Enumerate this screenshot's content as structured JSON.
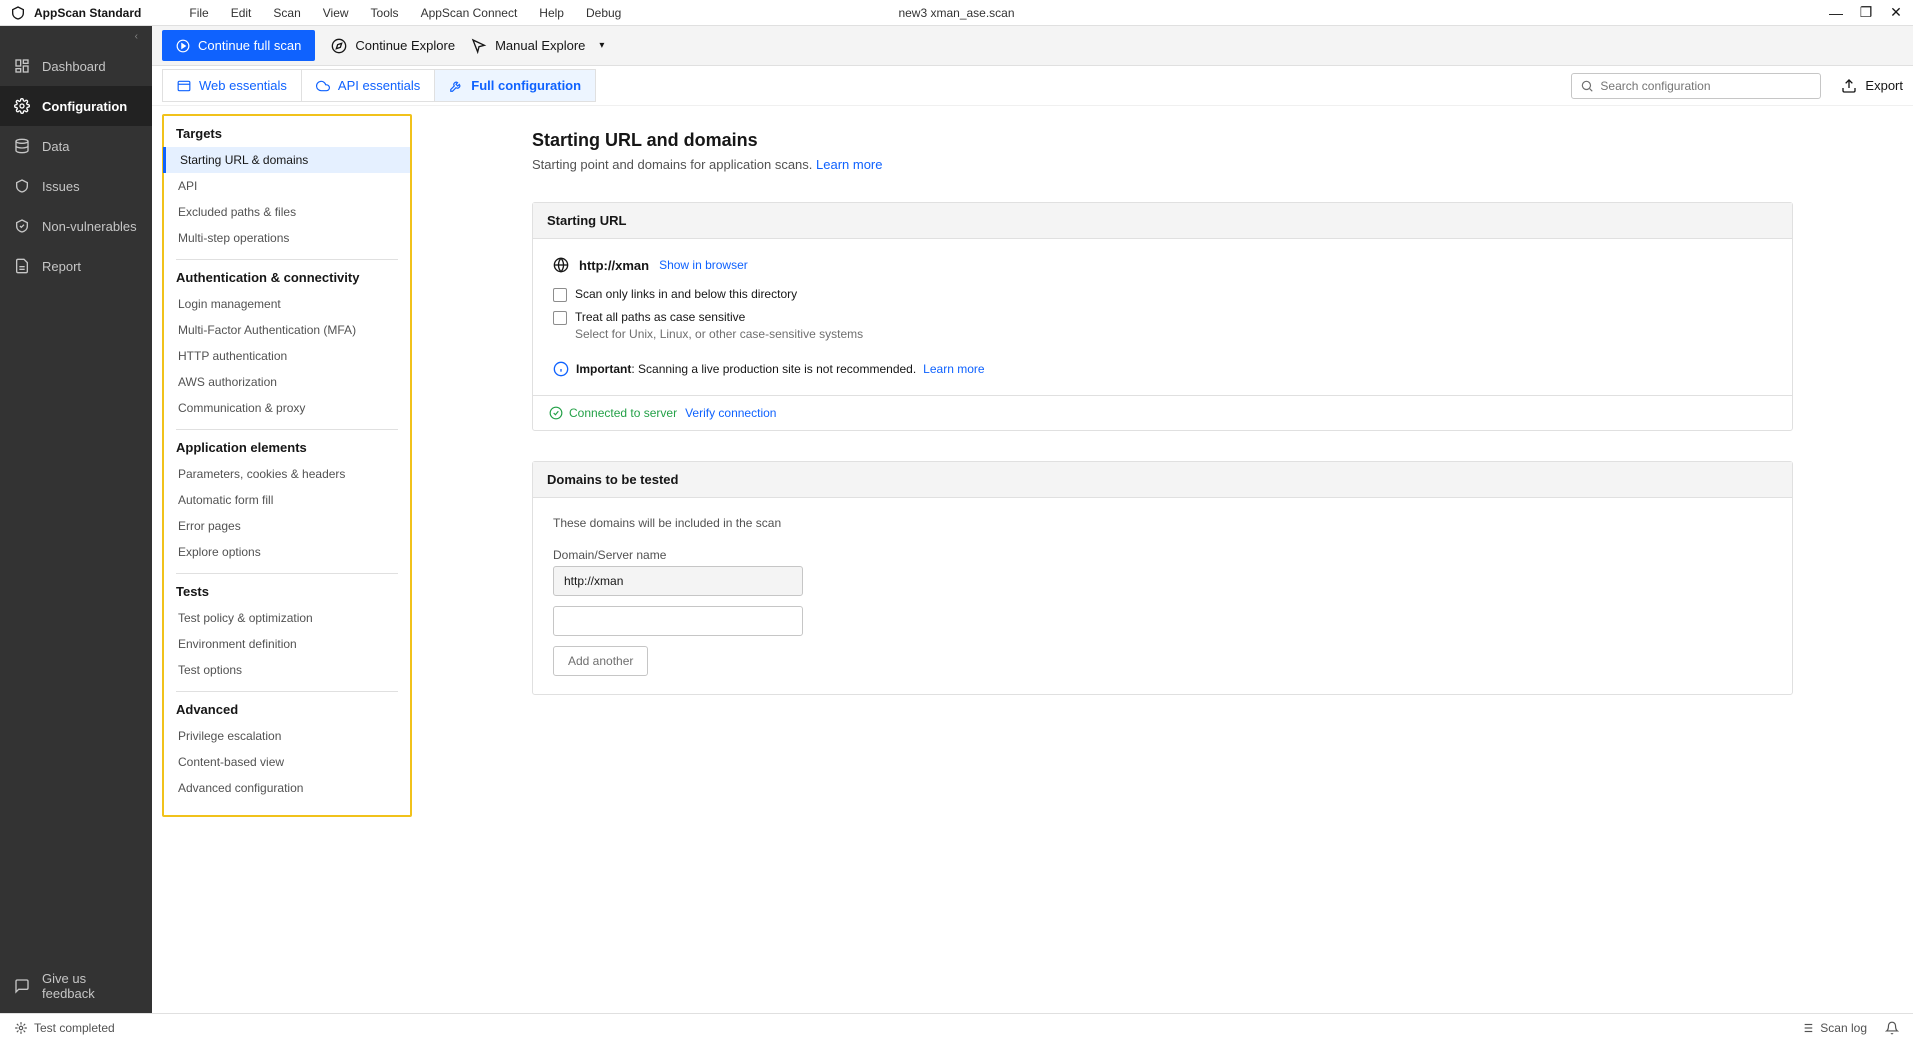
{
  "app": {
    "name": "AppScan Standard",
    "document": "new3 xman_ase.scan"
  },
  "menubar": [
    "File",
    "Edit",
    "Scan",
    "View",
    "Tools",
    "AppScan Connect",
    "Help",
    "Debug"
  ],
  "toolbar": {
    "continue_full": "Continue full scan",
    "continue_explore": "Continue Explore",
    "manual_explore": "Manual Explore"
  },
  "sidebar": {
    "items": [
      {
        "label": "Dashboard"
      },
      {
        "label": "Configuration"
      },
      {
        "label": "Data"
      },
      {
        "label": "Issues"
      },
      {
        "label": "Non-vulnerables"
      },
      {
        "label": "Report"
      }
    ],
    "feedback": "Give us feedback"
  },
  "tabs": {
    "web": "Web essentials",
    "api": "API essentials",
    "full": "Full configuration"
  },
  "search": {
    "placeholder": "Search configuration"
  },
  "export": "Export",
  "tree": {
    "g1": {
      "title": "Targets",
      "items": [
        "Starting URL & domains",
        "API",
        "Excluded paths & files",
        "Multi-step operations"
      ]
    },
    "g2": {
      "title": "Authentication & connectivity",
      "items": [
        "Login management",
        "Multi-Factor Authentication (MFA)",
        "HTTP authentication",
        "AWS authorization",
        "Communication & proxy"
      ]
    },
    "g3": {
      "title": "Application elements",
      "items": [
        "Parameters, cookies & headers",
        "Automatic form fill",
        "Error pages",
        "Explore options"
      ]
    },
    "g4": {
      "title": "Tests",
      "items": [
        "Test policy & optimization",
        "Environment definition",
        "Test options"
      ]
    },
    "g5": {
      "title": "Advanced",
      "items": [
        "Privilege escalation",
        "Content-based view",
        "Advanced configuration"
      ]
    }
  },
  "page": {
    "title": "Starting URL and domains",
    "subtitle": "Starting point and domains for application scans.",
    "learn_more": "Learn more",
    "starting_url": {
      "header": "Starting URL",
      "value": "http://xman",
      "show_in_browser": "Show in browser",
      "cb1": "Scan only links in and below this directory",
      "cb2": "Treat all paths as case sensitive",
      "cb2_sub": "Select for Unix, Linux, or other case-sensitive systems",
      "important_label": "Important",
      "important_text": ": Scanning a live production site is not recommended.",
      "important_link": "Learn more",
      "connected": "Connected to server",
      "verify": "Verify connection"
    },
    "domains": {
      "header": "Domains to be tested",
      "note": "These domains will be included in the scan",
      "field_label": "Domain/Server name",
      "value": "http://xman",
      "add": "Add another"
    }
  },
  "footer": {
    "status": "Test completed",
    "scanlog": "Scan log"
  }
}
